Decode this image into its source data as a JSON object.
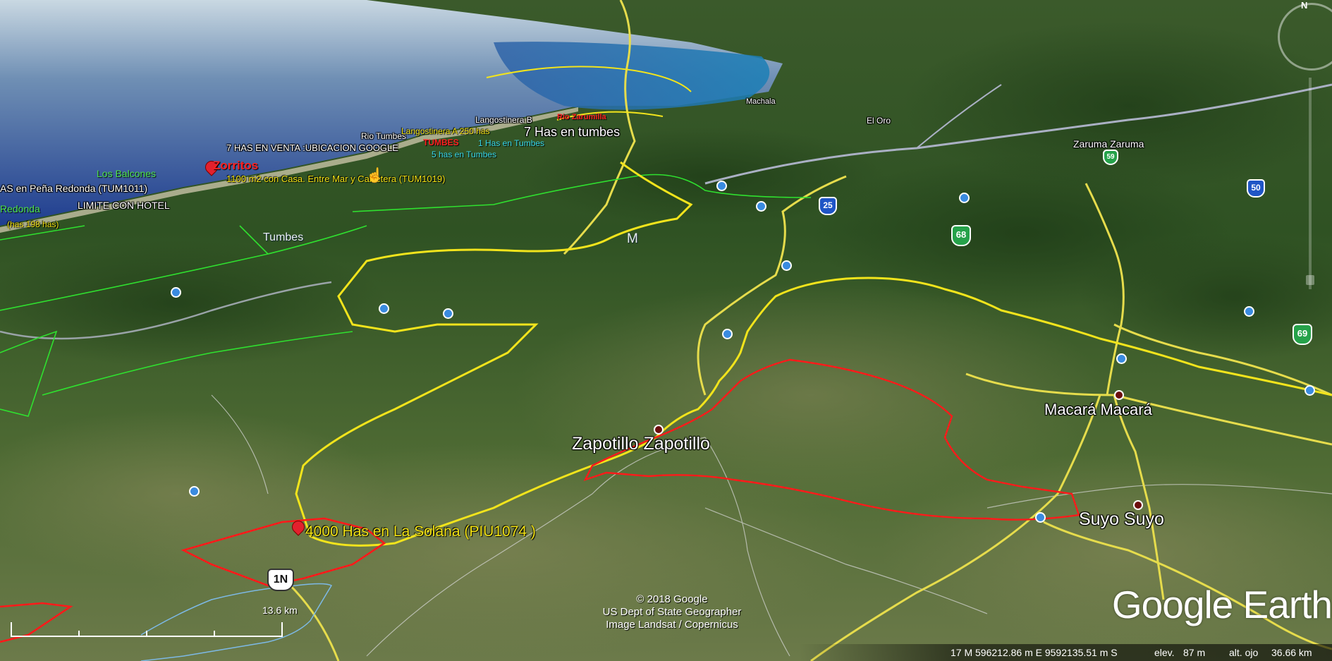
{
  "app": "Google Earth",
  "map": {
    "logo": "Google Earth",
    "copyright": [
      "© 2018 Google",
      "US Dept of State Geographer",
      "Image Landsat / Copernicus"
    ],
    "scale_label": "13.6 km",
    "north_label": "N"
  },
  "status": {
    "coords": "17 M 596212.86 m E 9592135.51 m S",
    "elevation_label": "elev.",
    "elevation_value": "87 m",
    "eye_label": "alt. ojo",
    "eye_value": "36.66 km"
  },
  "places": {
    "zapotillo": "Zapotillo  Zapotillo",
    "macara": "Macará  Macará",
    "suyo": "Suyo  Suyo",
    "zaruma": "Zaruma  Zaruma",
    "tumbes": "Tumbes",
    "el_oro": "El Oro",
    "machala": "Machala",
    "m": "M"
  },
  "placemarks": {
    "solana": "4000 Has en La Solana (PIU1074 )",
    "zorritos": "Zorritos",
    "los_balcones": "Los Balcones",
    "pena_redonda": "AS en Peña Redonda (TUM1011)",
    "limite_hotel": "LIMITE CON HOTEL",
    "redonda": "Redonda",
    "has_198": "(has 198 has)",
    "casa_1100": "1100 m2 con Casa. Entre Mar y Carretera (TUM1019)",
    "has_7_venta": "7 HAS EN VENTA :UBICACION  GOOGLE",
    "rio_tumbes": "Rio Tumbes",
    "langostinera_a": "Langostinera A 250 has",
    "langostinera_b": "Langostinera B",
    "has_7_tumbes": "7 Has en tumbes",
    "has_5_tumbes": "5 has en Tumbes",
    "has_tumbes_c": "1 Has en Tumbes",
    "rio_zarumilla": "Rio Zarumilla",
    "tumbes_red": "TUMBES"
  },
  "roads": {
    "r1n": "1N",
    "r25": "25",
    "r68": "68",
    "r50": "50",
    "r69": "69",
    "r59": "59"
  }
}
